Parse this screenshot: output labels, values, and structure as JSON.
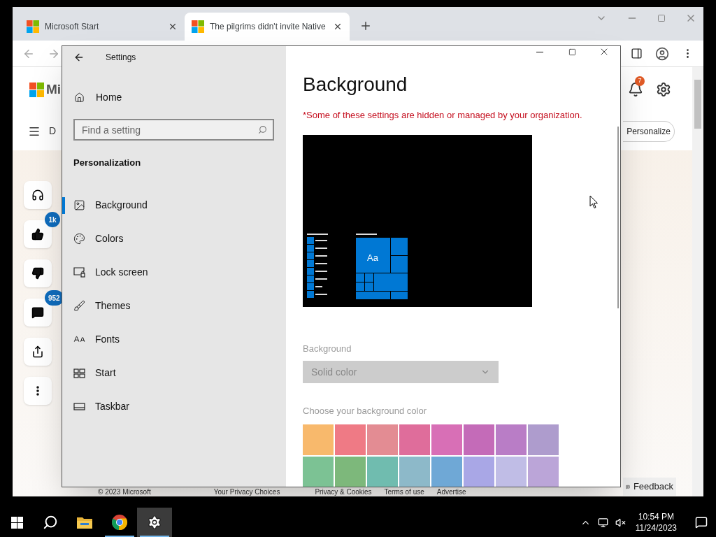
{
  "browser": {
    "tabs": [
      {
        "title": "Microsoft Start",
        "selected": false
      },
      {
        "title": "The pilgrims didn't invite Native",
        "selected": true
      }
    ],
    "page": {
      "logo_text": "Mi",
      "nav_text": "D",
      "notification_badge": "7",
      "personalize_button": "Personalize",
      "side_actions": [
        {
          "kind": "plain"
        },
        {
          "kind": "badged",
          "badge": "1k"
        },
        {
          "kind": "plain"
        },
        {
          "kind": "badged",
          "badge": "952"
        },
        {
          "kind": "plain"
        },
        {
          "kind": "plain"
        }
      ],
      "footer_links": [
        "© 2023 Microsoft",
        "Your Privacy Choices",
        "Privacy & Cookies",
        "Terms of use",
        "Advertise"
      ],
      "feedback": "Feedback"
    }
  },
  "settings": {
    "title": "Settings",
    "home": "Home",
    "search": {
      "placeholder": "Find a setting"
    },
    "section": "Personalization",
    "nav": [
      {
        "label": "Background",
        "selected": true
      },
      {
        "label": "Colors",
        "selected": false
      },
      {
        "label": "Lock screen",
        "selected": false
      },
      {
        "label": "Themes",
        "selected": false
      },
      {
        "label": "Fonts",
        "selected": false
      },
      {
        "label": "Start",
        "selected": false
      },
      {
        "label": "Taskbar",
        "selected": false
      }
    ],
    "heading": "Background",
    "warning": "*Some of these settings are hidden or managed by your organization.",
    "preview_tile": "Aa",
    "background_label": "Background",
    "background_dropdown": {
      "value": "Solid color",
      "disabled": true
    },
    "color_label": "Choose your background color",
    "colors": [
      {
        "color": "#f8b96c"
      },
      {
        "color": "#ef7a85"
      },
      {
        "color": "#e38c93"
      },
      {
        "color": "#df6d9b"
      },
      {
        "color": "#d86fb6"
      },
      {
        "color": "#c46bb8"
      },
      {
        "color": "#b97dc6"
      },
      {
        "color": "#ae9ccd"
      },
      {
        "color": "#7cc294"
      },
      {
        "color": "#7db87b"
      },
      {
        "color": "#70bcaf"
      },
      {
        "color": "#8db9c9"
      },
      {
        "color": "#6fa8d6"
      },
      {
        "color": "#a9a7e6"
      },
      {
        "color": "#c0bde6"
      },
      {
        "color": "#bba5d8"
      }
    ]
  },
  "taskbar": {
    "apps": [
      {
        "running": false,
        "selected": false
      },
      {
        "running": true,
        "selected": false
      },
      {
        "running": true,
        "selected": true
      }
    ],
    "time": "10:54 PM",
    "date": "11/24/2023"
  }
}
